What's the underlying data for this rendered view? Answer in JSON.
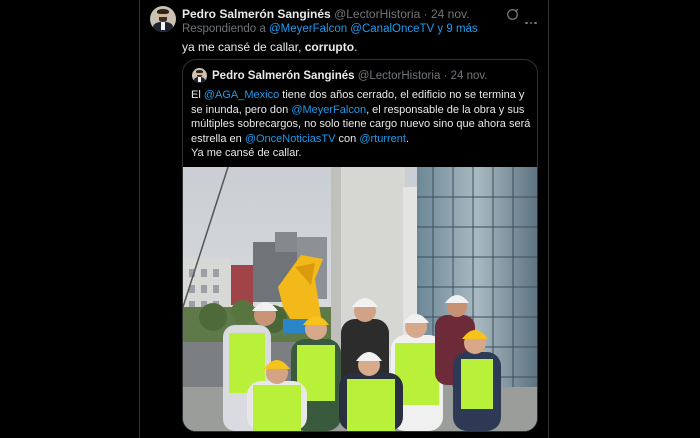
{
  "tweet": {
    "author_name": "Pedro Salmerón Sanginés",
    "handle": "@LectorHistoria",
    "separator": "·",
    "date": "24 nov.",
    "replying_prefix": "Respondiendo a",
    "replying_to": "@MeyerFalcon @CanalOnceTV y 9 más",
    "text_plain": "ya me cansé de callar, ",
    "text_bold": "corrupto",
    "text_end": "."
  },
  "quote": {
    "author_name": "Pedro Salmerón Sanginés",
    "handle": "@LectorHistoria",
    "separator": "·",
    "date": "24 nov.",
    "p1_a": "El ",
    "p1_m1": "@AGA_Mexico",
    "p1_b": " tiene dos años cerrado, el edificio no se termina y se inunda, pero don ",
    "p1_m2": "@MeyerFalcon",
    "p1_c": ", el responsable de la obra y sus múltiples sobrecargos, no solo tiene cargo nuevo sino que ahora será estrella en ",
    "p1_m3": "@OnceNoticiasTV",
    "p1_d": " con ",
    "p1_m4": "@rturrent",
    "p1_e": ".",
    "p2": "Ya me cansé de callar."
  },
  "icons": [
    "grok-icon",
    "more-icon"
  ],
  "colors": {
    "link": "#1d9bf0",
    "muted": "#71767b",
    "text": "#e7e9ea",
    "border": "#2f3336",
    "vest": "#b8f03a",
    "helmet_yellow": "#f6c21c"
  }
}
